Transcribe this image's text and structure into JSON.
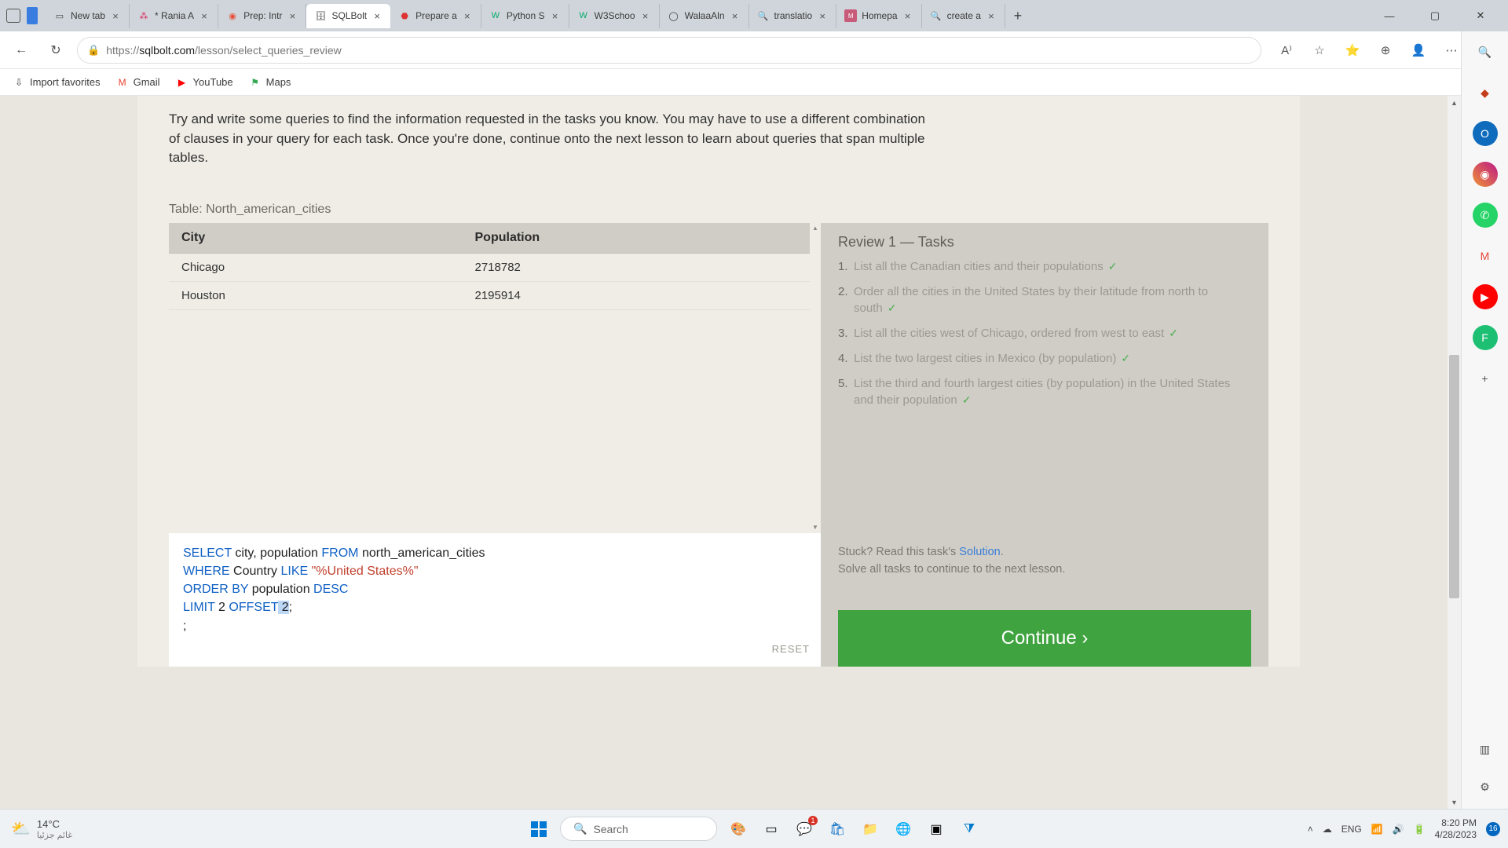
{
  "tabs": [
    {
      "label": "New tab"
    },
    {
      "label": "* Rania A"
    },
    {
      "label": "Prep: Intr"
    },
    {
      "label": "SQLBolt"
    },
    {
      "label": "Prepare a"
    },
    {
      "label": "Python S"
    },
    {
      "label": "W3Schoo"
    },
    {
      "label": "WalaaAln"
    },
    {
      "label": "translatio"
    },
    {
      "label": "Homepa"
    },
    {
      "label": "create a"
    }
  ],
  "url": {
    "scheme": "https://",
    "host": "sqlbolt.com",
    "path": "/lesson/select_queries_review"
  },
  "bookmarks": [
    {
      "label": "Import favorites"
    },
    {
      "label": "Gmail"
    },
    {
      "label": "YouTube"
    },
    {
      "label": "Maps"
    }
  ],
  "instructions": "Try and write some queries to find the information requested in the tasks you know. You may have to use a different combination of clauses in your query for each task. Once you're done, continue onto the next lesson to learn about queries that span multiple tables.",
  "table": {
    "title": "Table: North_american_cities",
    "headers": [
      "City",
      "Population"
    ],
    "rows": [
      [
        "Chicago",
        "2718782"
      ],
      [
        "Houston",
        "2195914"
      ]
    ]
  },
  "tasks": {
    "title": "Review 1 — Tasks",
    "items": [
      "List all the Canadian cities and their populations",
      "Order all the cities in the United States by their latitude from north to south",
      "List all the cities west of Chicago, ordered from west to east",
      "List the two largest cities in Mexico (by population)",
      "List the third and fourth largest cities (by population) in the United States and their population"
    ]
  },
  "sql": {
    "l1_a": "SELECT",
    "l1_b": " city, population ",
    "l1_c": "FROM",
    "l1_d": " north_american_cities",
    "l2_a": "WHERE",
    "l2_b": " Country ",
    "l2_c": "LIKE",
    "l2_d": " ",
    "l2_e": "\"%United States%\"",
    "l3_a": "ORDER",
    "l3_b": " ",
    "l3_c": "BY",
    "l3_d": " population ",
    "l3_e": "DESC",
    "l4_a": "LIMIT",
    "l4_b": " 2 ",
    "l4_c": "OFFSET",
    "l4_d": " ",
    "l4_e": "2",
    "l4_f": ";",
    "l5": ";"
  },
  "reset": "RESET",
  "help": {
    "stuck": "Stuck? Read this task's ",
    "solution": "Solution",
    "solve": "Solve all tasks to continue to the next lesson."
  },
  "continue": "Continue ›",
  "taskbar": {
    "temp": "14°C",
    "weather_desc": "غائم جزئيا",
    "search_placeholder": "Search",
    "lang": "ENG",
    "time": "8:20 PM",
    "date": "4/28/2023",
    "notif_count": "16"
  }
}
